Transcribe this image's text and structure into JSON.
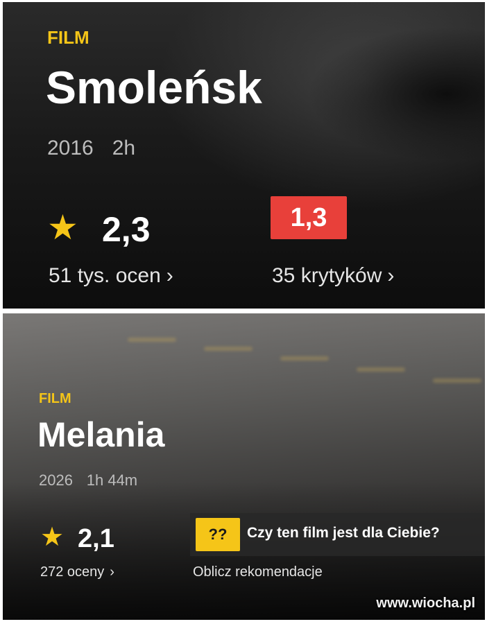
{
  "cards": [
    {
      "kind": "FILM",
      "title": "Smoleńsk",
      "year": "2016",
      "duration": "2h",
      "rating": "2,3",
      "ratings_count_label": "51 tys. ocen",
      "critic_score": "1,3",
      "critics_count_label": "35 krytyków",
      "colors": {
        "accent": "#f5c518",
        "critic": "#e8403a"
      }
    },
    {
      "kind": "FILM",
      "title": "Melania",
      "year": "2026",
      "duration": "1h 44m",
      "rating": "2,1",
      "ratings_count_label": "272 oceny",
      "recommendation": {
        "badge": "??",
        "question": "Czy ten film jest dla Ciebie?",
        "action": "Oblicz rekomendacje"
      },
      "colors": {
        "accent": "#f5c518"
      }
    }
  ],
  "watermark": "www.wiocha.pl",
  "icons": {
    "star": "★",
    "chevron": "›"
  }
}
